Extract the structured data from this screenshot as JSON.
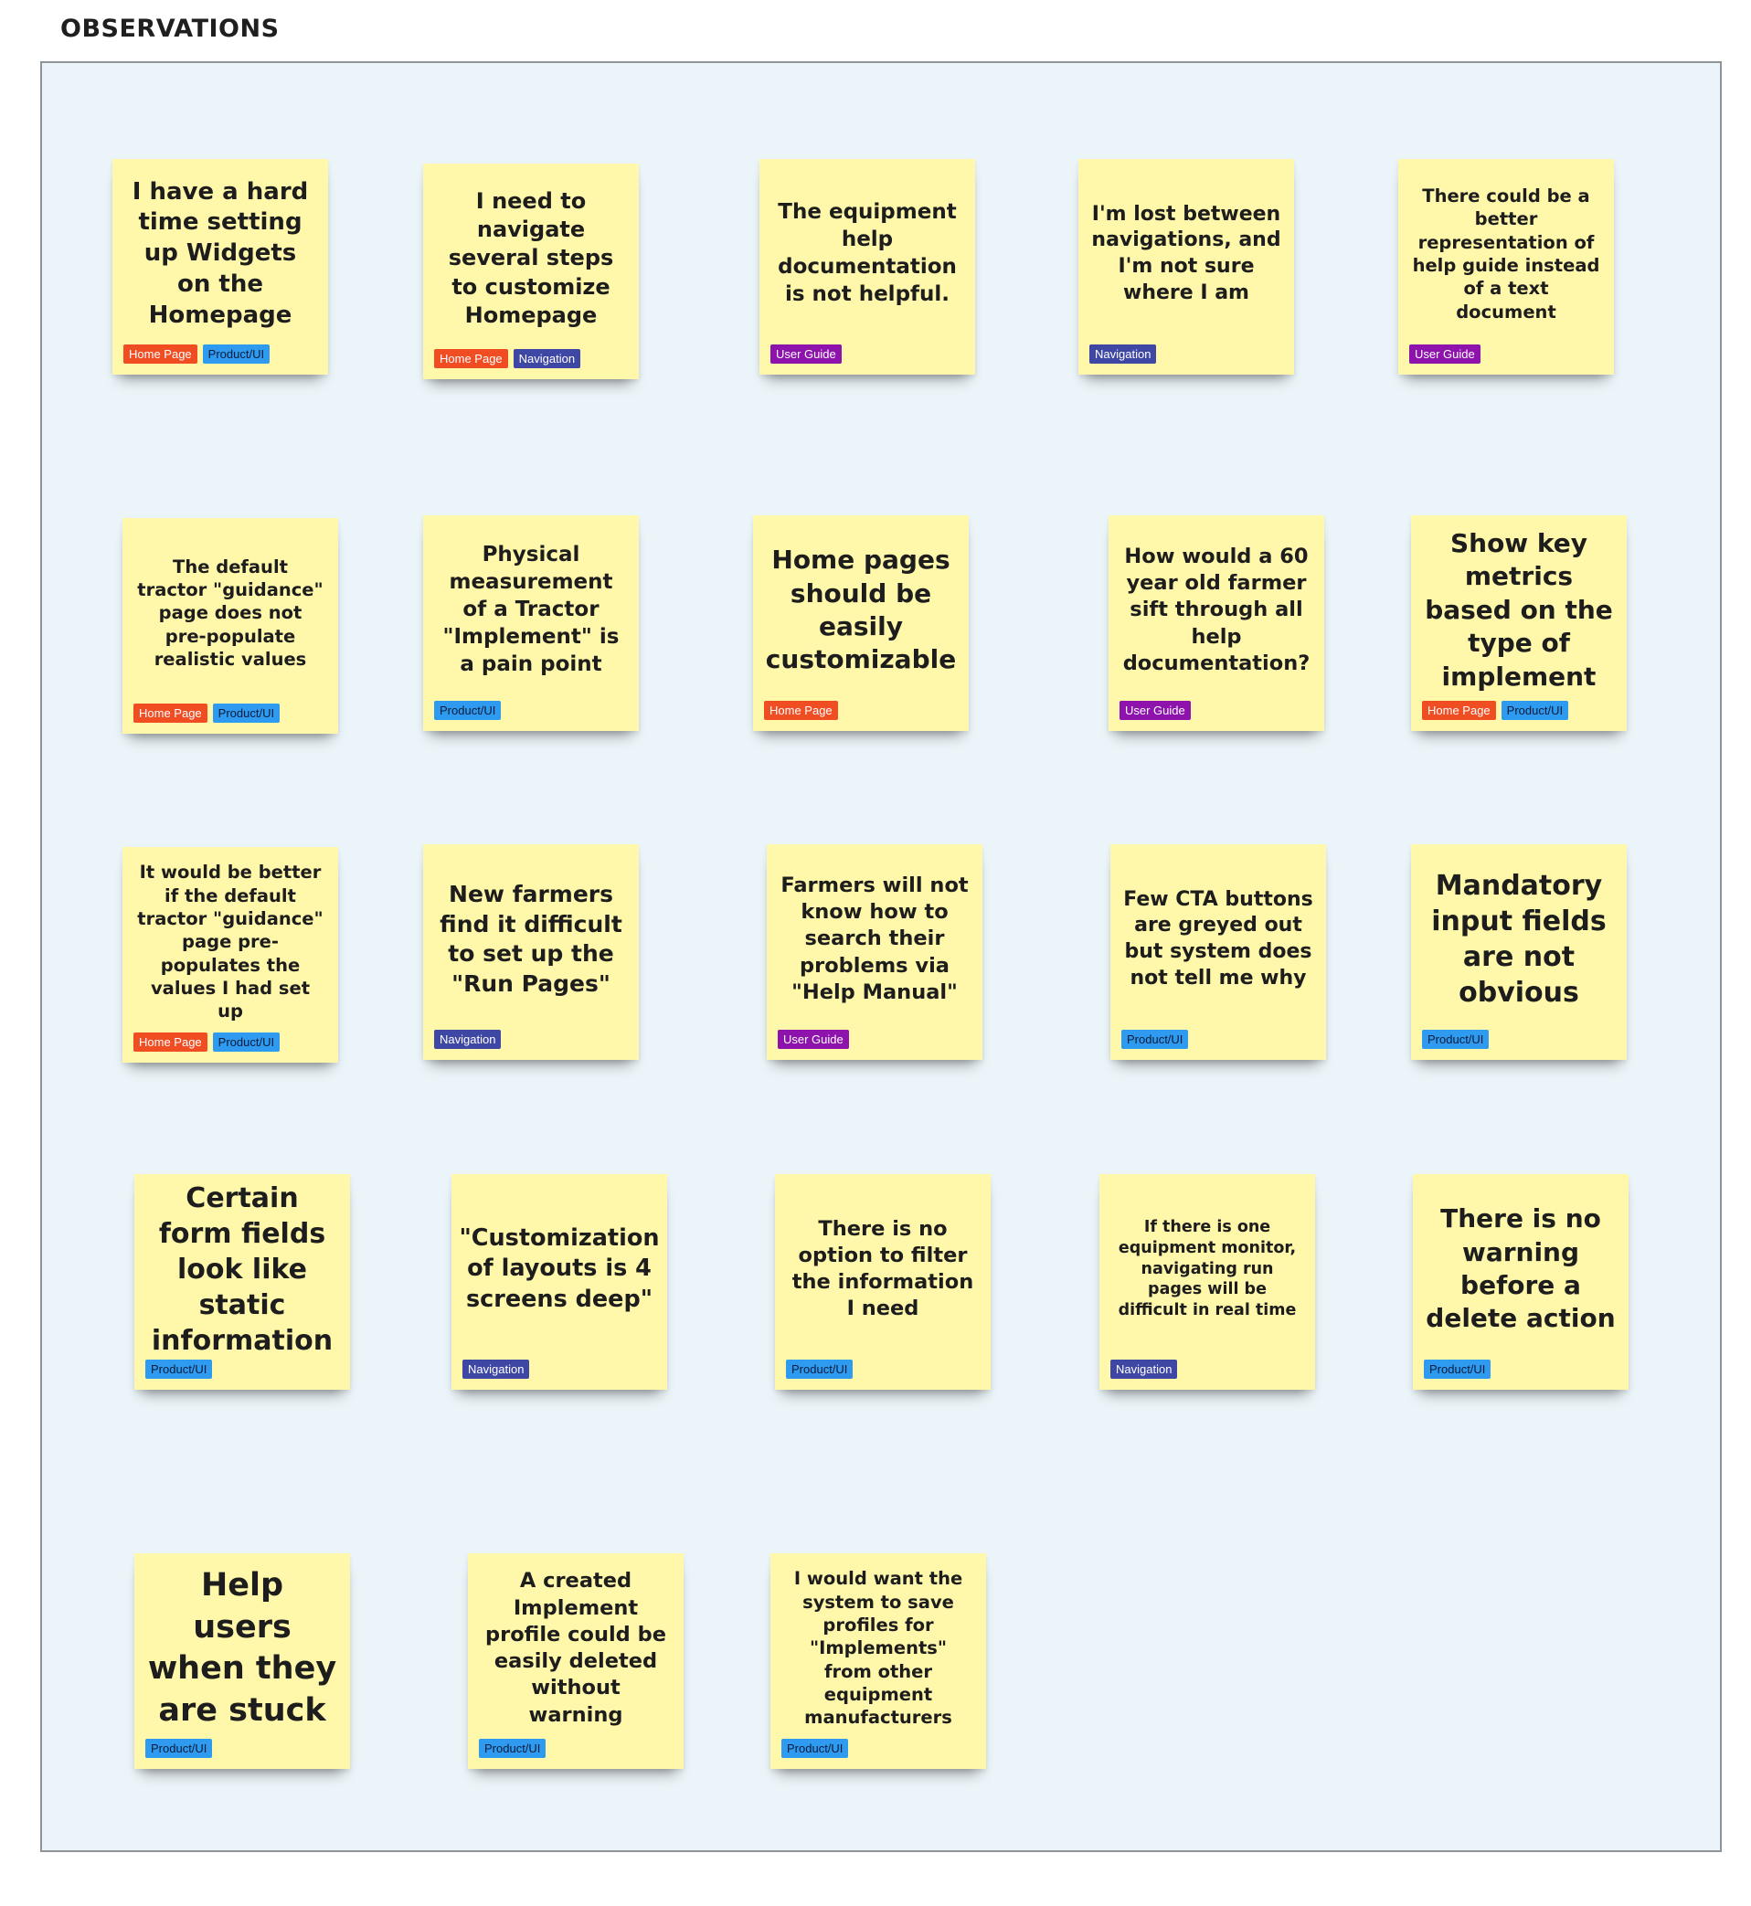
{
  "page": {
    "title": "OBSERVATIONS"
  },
  "tag_colors": {
    "Home Page": "#f04d23",
    "Product/UI": "#2e9af0",
    "Navigation": "#3f47a5",
    "User Guide": "#8d13ac"
  },
  "note_color": "#fff7a9",
  "board_color": "#ebf4f8",
  "notes": [
    {
      "text": "I have a hard time setting up Widgets on the Homepage",
      "tags": [
        "Home Page",
        "Product/UI"
      ]
    },
    {
      "text": "I need to navigate several steps to customize Homepage",
      "tags": [
        "Home Page",
        "Navigation"
      ]
    },
    {
      "text": "The  equipment help documentation is not helpful.",
      "tags": [
        "User Guide"
      ]
    },
    {
      "text": "I'm lost between navigations, and I'm not sure where I am",
      "tags": [
        "Navigation"
      ]
    },
    {
      "text": "There could be a better representation of help guide instead of a text document",
      "tags": [
        "User Guide"
      ]
    },
    {
      "text": "The default tractor \"guidance\" page does not pre-populate realistic values",
      "tags": [
        "Home Page",
        "Product/UI"
      ]
    },
    {
      "text": "Physical measurement of a Tractor \"Implement\" is a pain point",
      "tags": [
        "Product/UI"
      ]
    },
    {
      "text": "Home pages should be easily customizable",
      "tags": [
        "Home Page"
      ]
    },
    {
      "text": "How would a 60 year old farmer sift through all help documentation?",
      "tags": [
        "User Guide"
      ]
    },
    {
      "text": "Show key metrics based on the type of implement",
      "tags": [
        "Home Page",
        "Product/UI"
      ]
    },
    {
      "text": "It would be better if the default tractor \"guidance\" page pre-populates the values I had set up",
      "tags": [
        "Home Page",
        "Product/UI"
      ]
    },
    {
      "text": "New farmers find it difficult to set up the \"Run Pages\"",
      "tags": [
        "Navigation"
      ]
    },
    {
      "text": "Farmers will not know how to search their problems via \"Help Manual\"",
      "tags": [
        "User Guide"
      ]
    },
    {
      "text": "Few CTA buttons are greyed out but system does not tell me why",
      "tags": [
        "Product/UI"
      ]
    },
    {
      "text": "Mandatory input fields are not obvious",
      "tags": [
        "Product/UI"
      ]
    },
    {
      "text": "Certain form fields look like static information",
      "tags": [
        "Product/UI"
      ]
    },
    {
      "text": "\"Customization of layouts is 4 screens deep\"",
      "tags": [
        "Navigation"
      ]
    },
    {
      "text": "There is no option to filter the information I need",
      "tags": [
        "Product/UI"
      ]
    },
    {
      "text": "If there is one equipment monitor, navigating run pages will be difficult in real time",
      "tags": [
        "Navigation"
      ]
    },
    {
      "text": "There is no warning before a delete action",
      "tags": [
        "Product/UI"
      ]
    },
    {
      "text": "Help users when they are stuck",
      "tags": [
        "Product/UI"
      ]
    },
    {
      "text": "A created Implement profile could be easily deleted without warning",
      "tags": [
        "Product/UI"
      ]
    },
    {
      "text": "I would want the system to save profiles for \"Implements\" from other equipment manufacturers",
      "tags": [
        "Product/UI"
      ]
    }
  ]
}
